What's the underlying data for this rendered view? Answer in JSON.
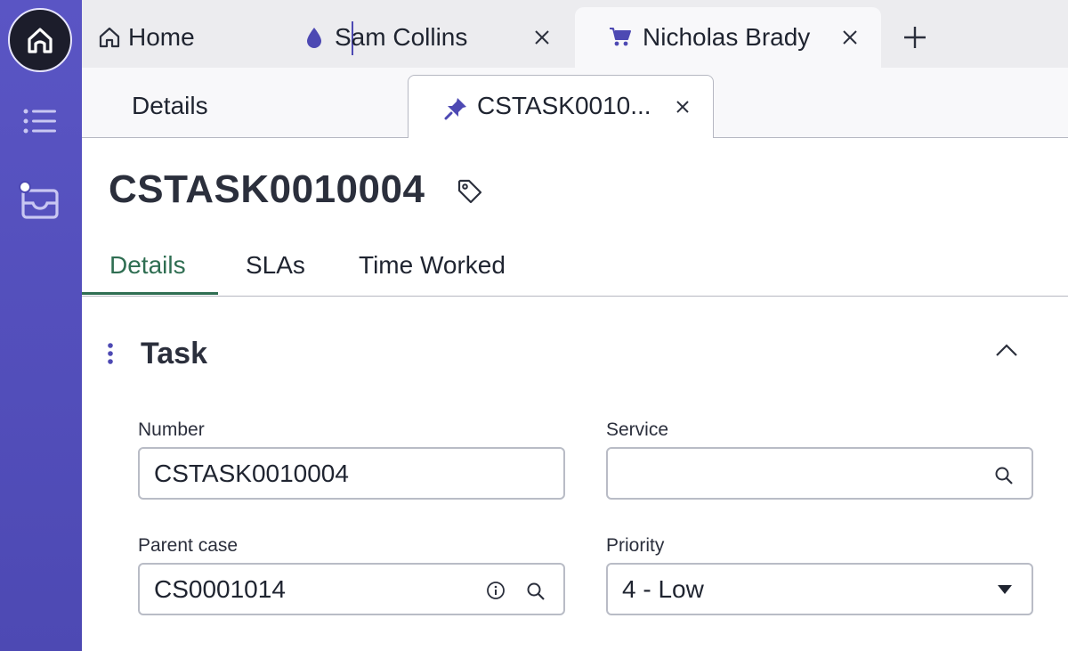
{
  "workspace_tabs": [
    {
      "label": "Home",
      "icon": "home-icon"
    },
    {
      "label": "Sam Collins",
      "icon": "drop-icon",
      "closable": true
    },
    {
      "label": "Nicholas Brady",
      "icon": "cart-icon",
      "closable": true,
      "active": true
    }
  ],
  "sub_tabs": [
    {
      "label": "Details"
    },
    {
      "label": "CSTASK0010...",
      "icon": "pin-icon",
      "closable": true,
      "active": true
    }
  ],
  "record": {
    "title": "CSTASK0010004"
  },
  "form_tabs": [
    {
      "label": "Details",
      "active": true
    },
    {
      "label": "SLAs"
    },
    {
      "label": "Time Worked"
    }
  ],
  "section": {
    "title": "Task"
  },
  "fields": {
    "number": {
      "label": "Number",
      "value": "CSTASK0010004"
    },
    "service": {
      "label": "Service",
      "value": ""
    },
    "parent_case": {
      "label": "Parent case",
      "value": "CS0001014"
    },
    "priority": {
      "label": "Priority",
      "value": "4 - Low"
    }
  },
  "colors": {
    "rail": "#5a55c4",
    "accent_green": "#2f6e52",
    "accent_purple": "#4d49b3"
  }
}
